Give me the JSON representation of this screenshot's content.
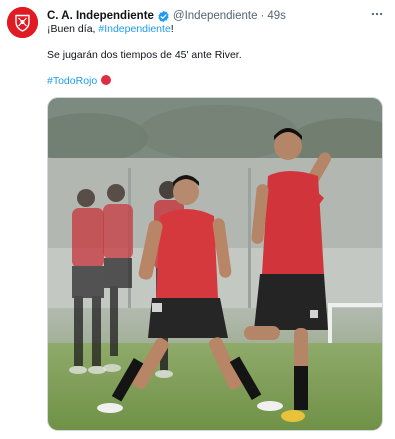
{
  "tweet": {
    "display_name": "C. A. Independiente",
    "handle": "@Independiente",
    "separator": "·",
    "time": "49s",
    "line1_prefix": "¡Buen día, ",
    "line1_hashtag": "#Independiente",
    "line1_suffix": "!",
    "line2": "Se jugarán dos tiempos de 45' ante River.",
    "line3_hashtag": "#TodoRojo"
  },
  "colors": {
    "brand_red": "#e11b22",
    "link_blue": "#1d9bf0",
    "verified_blue": "#1d9bf0",
    "muted_text": "#536471"
  },
  "icons": {
    "avatar": "club-crest-icon",
    "verified": "verified-badge-icon",
    "more": "more-options-icon",
    "emoji": "red-circle-emoji"
  }
}
